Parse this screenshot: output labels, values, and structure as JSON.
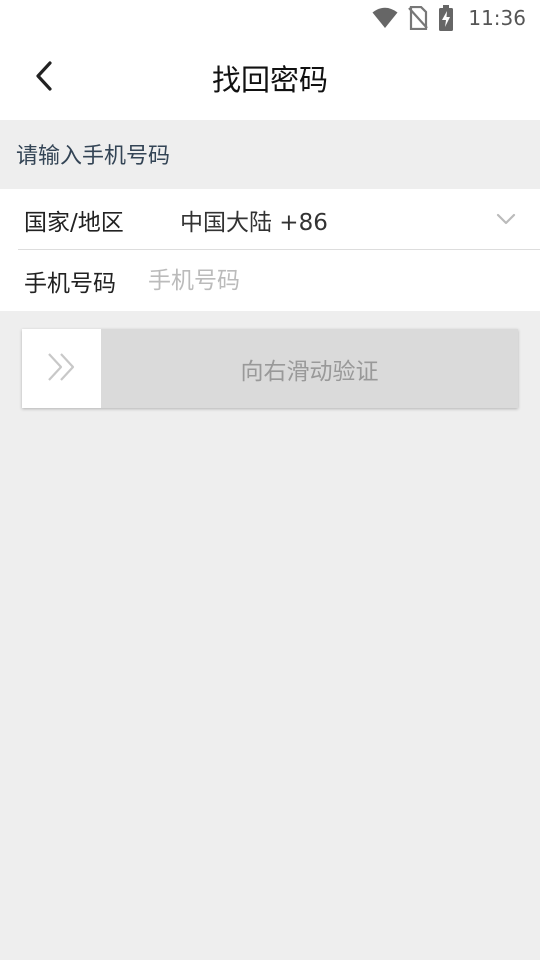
{
  "status_bar": {
    "time": "11:36",
    "icons": [
      "wifi-icon",
      "no-sim-icon",
      "battery-charging-icon"
    ]
  },
  "header": {
    "title": "找回密码",
    "back_icon": "back-arrow-icon"
  },
  "form": {
    "section_hint": "请输入手机号码",
    "country": {
      "label": "国家/地区",
      "value": "中国大陆 +86",
      "icon": "chevron-down-icon"
    },
    "phone": {
      "label": "手机号码",
      "placeholder": "手机号码",
      "value": ""
    }
  },
  "slider": {
    "text": "向右滑动验证",
    "handle_icon": "double-chevron-right-icon"
  },
  "colors": {
    "background": "#eeeeee",
    "surface": "#ffffff",
    "slider_track": "#dadada"
  }
}
